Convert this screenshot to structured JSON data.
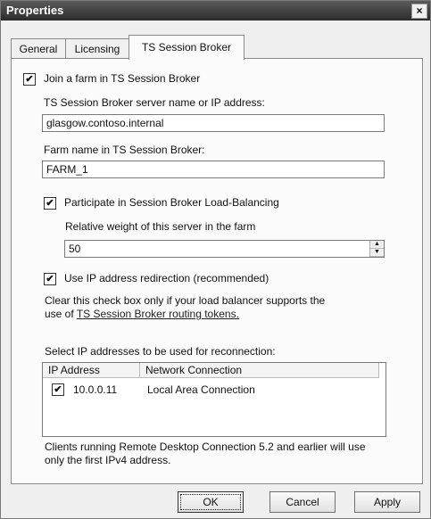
{
  "window": {
    "title": "Properties",
    "close_glyph": "×"
  },
  "tabs": [
    {
      "label": "General"
    },
    {
      "label": "Licensing"
    },
    {
      "label": "TS Session Broker"
    }
  ],
  "join_farm": {
    "label": "Join a farm in TS Session Broker",
    "checked": true,
    "mark": "✔"
  },
  "server": {
    "label": "TS Session Broker server name or IP address:",
    "value": "glasgow.contoso.internal"
  },
  "farm": {
    "label": "Farm name in TS Session Broker:",
    "value": "FARM_1"
  },
  "load_balancing": {
    "label": "Participate in Session Broker Load-Balancing",
    "checked": true,
    "mark": "✔"
  },
  "weight": {
    "label": "Relative weight of this server in the farm",
    "value": "50",
    "up": "▲",
    "down": "▼"
  },
  "ip_redirection": {
    "label": "Use IP address redirection (recommended)",
    "checked": true,
    "mark": "✔"
  },
  "redirection_note": {
    "line1": "Clear this check box only if your load balancer supports the",
    "line2_prefix": "use of ",
    "link": "TS Session Broker routing tokens."
  },
  "reconnection": {
    "label": "Select IP addresses to be used for reconnection:",
    "columns": [
      "IP Address",
      "Network Connection"
    ],
    "rows": [
      {
        "ip": "10.0.0.11",
        "connection": "Local Area Connection",
        "checked": true,
        "mark": "✔"
      }
    ]
  },
  "footer_note": {
    "line1": "Clients running Remote Desktop Connection 5.2 and earlier will use",
    "line2": "only the first IPv4 address."
  },
  "buttons": {
    "ok": "OK",
    "cancel": "Cancel",
    "apply": "Apply"
  }
}
